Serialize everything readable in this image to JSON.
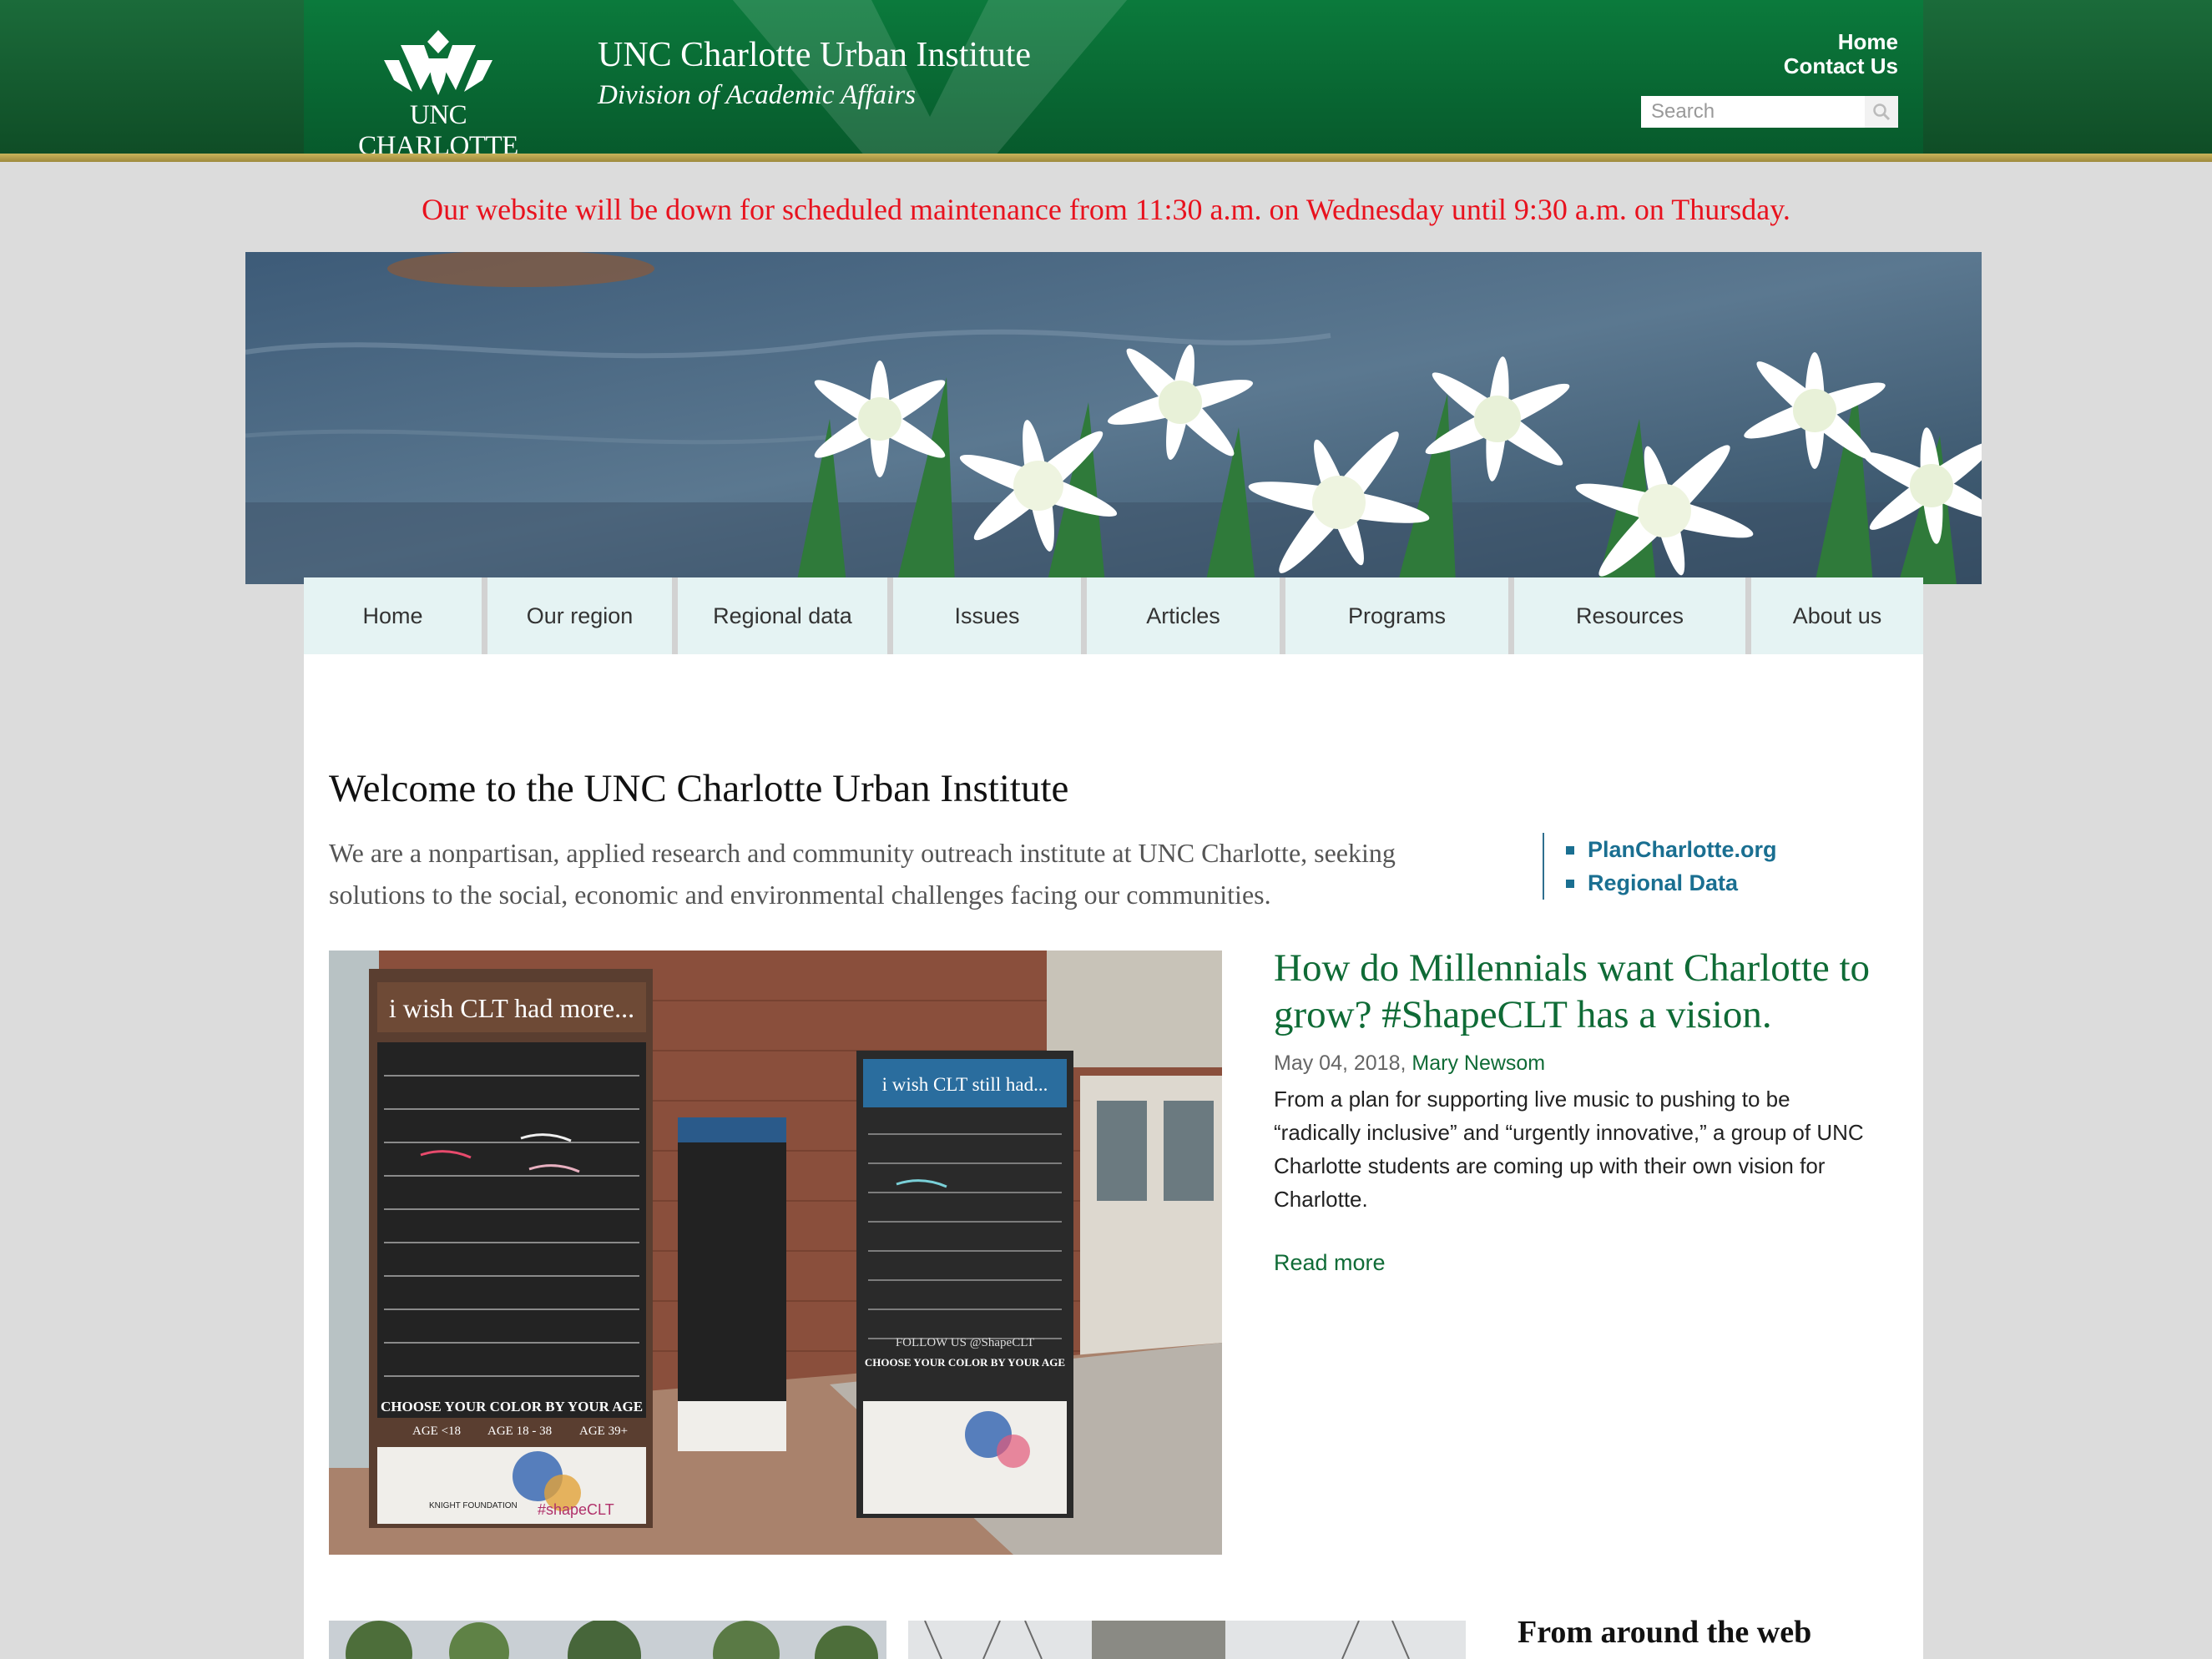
{
  "header": {
    "logo_text": "UNC CHARLOTTE",
    "title": "UNC Charlotte Urban Institute",
    "subtitle": "Division of Academic Affairs",
    "util_links": [
      {
        "label": "Home"
      },
      {
        "label": "Contact Us"
      }
    ],
    "search_placeholder": "Search"
  },
  "notice": "Our website will be down for scheduled maintenance from 11:30 a.m. on Wednesday until 9:30 a.m. on Thursday.",
  "nav": [
    {
      "label": "Home"
    },
    {
      "label": "Our region"
    },
    {
      "label": "Regional data"
    },
    {
      "label": "Issues"
    },
    {
      "label": "Articles"
    },
    {
      "label": "Programs"
    },
    {
      "label": "Resources"
    },
    {
      "label": "About us"
    }
  ],
  "welcome": {
    "heading": "Welcome to the UNC Charlotte Urban Institute",
    "intro": "We are a nonpartisan, applied research and community outreach institute at UNC Charlotte, seeking solutions to the social, economic and environmental challenges facing our communities.",
    "quick_links": [
      {
        "label": "PlanCharlotte.org"
      },
      {
        "label": "Regional Data"
      }
    ]
  },
  "feature": {
    "title": "How do Millennials want Charlotte to grow? #ShapeCLT has a vision.",
    "date": "May 04, 2018,",
    "author": "Mary Newsom",
    "summary": "From a plan for supporting live music to pushing to be “radically inclusive” and “urgently innovative,” a group of UNC Charlotte students are coming up with their own vision for Charlotte.",
    "read_more": "Read more",
    "image": {
      "board1_heading": "i wish CLT had more...",
      "board2_heading": "i wish CLT still had...",
      "board_footer": "CHOOSE YOUR COLOR BY YOUR AGE",
      "age_groups": [
        "AGE <18",
        "AGE 18 - 38",
        "AGE 39+"
      ],
      "follow": "FOLLOW US @ShapeCLT",
      "sponsor": "KNIGHT FOUNDATION",
      "hashtag": "#shapeCLT"
    }
  },
  "sidebar": {
    "around_web_heading": "From around the web"
  },
  "colors": {
    "header_green": "#0b7a3c",
    "link_green": "#0f6b36",
    "link_blue": "#1a6f91",
    "notice_red": "#e8121e",
    "nav_bg": "#e5f3f3"
  }
}
